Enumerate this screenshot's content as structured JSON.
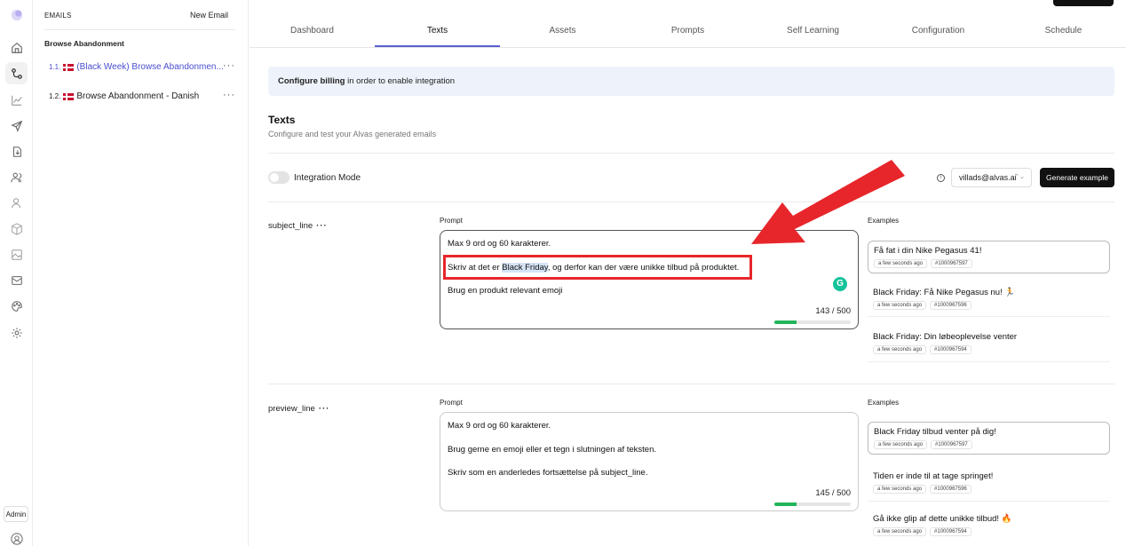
{
  "rail": {
    "icons": [
      "logo-icon",
      "home-icon",
      "workflow-icon",
      "chart-icon",
      "send-icon",
      "import-icon",
      "users-icon",
      "user-icon",
      "box-icon",
      "image-icon",
      "mail-icon",
      "palette-icon",
      "settings-icon"
    ],
    "admin_label": "Admin"
  },
  "sidebar": {
    "header": "EMAILS",
    "new_email": "New Email",
    "group": "Browse Abandonment",
    "items": [
      {
        "num": "1.1.",
        "label": "(Black Week) Browse Abandonmen...",
        "active": true
      },
      {
        "num": "1.2.",
        "label": "Browse Abandonment - Danish",
        "active": false
      }
    ]
  },
  "tabs": [
    "Dashboard",
    "Texts",
    "Assets",
    "Prompts",
    "Self Learning",
    "Configuration",
    "Schedule"
  ],
  "active_tab": "Texts",
  "banner": {
    "bold": "Configure billing",
    "rest": " in order to enable integration"
  },
  "section": {
    "title": "Texts",
    "subtitle": "Configure and test your Alvas generated emails"
  },
  "controls": {
    "integration_mode": "Integration Mode",
    "integration_on": false,
    "user_select": "villads@alvas.ai",
    "generate": "Generate example"
  },
  "fields": [
    {
      "name": "subject_line",
      "prompt_label": "Prompt",
      "lines": [
        "Max 9 ord og 60 karakterer.",
        "Skriv at det er ",
        "Black Friday",
        ", og derfor kan der være unikke tilbud på produktet.",
        "Brug en produkt relevant emoji"
      ],
      "counter": "143 / 500",
      "progress": 0.286,
      "examples_label": "Examples",
      "examples": [
        {
          "text": "Få fat i din Nike Pegasus 41!",
          "time": "a few seconds ago",
          "id": "#1000967597"
        },
        {
          "text": "Black Friday: Få Nike Pegasus nu! 🏃",
          "time": "a few seconds ago",
          "id": "#1000967596"
        },
        {
          "text": "Black Friday: Din løbeoplevelse venter",
          "time": "a few seconds ago",
          "id": "#1000967594"
        }
      ]
    },
    {
      "name": "preview_line",
      "prompt_label": "Prompt",
      "lines": [
        "Max 9 ord og 60 karakterer.",
        "Brug gerne en emoji eller et tegn i slutningen af teksten.",
        "Skriv som en anderledes fortsættelse på subject_line."
      ],
      "counter": "145 / 500",
      "progress": 0.29,
      "examples_label": "Examples",
      "examples": [
        {
          "text": "Black Friday tilbud venter på dig!",
          "time": "a few seconds ago",
          "id": "#1000967597"
        },
        {
          "text": "Tiden er inde til at tage springet!",
          "time": "a few seconds ago",
          "id": "#1000967596"
        },
        {
          "text": "Gå ikke glip af dette unikke tilbud! 🔥",
          "time": "a few seconds ago",
          "id": "#1000967594"
        }
      ]
    }
  ],
  "colors": {
    "accent": "#5a5fd6",
    "annotation": "#e7262b",
    "progress": "#22b45c"
  }
}
